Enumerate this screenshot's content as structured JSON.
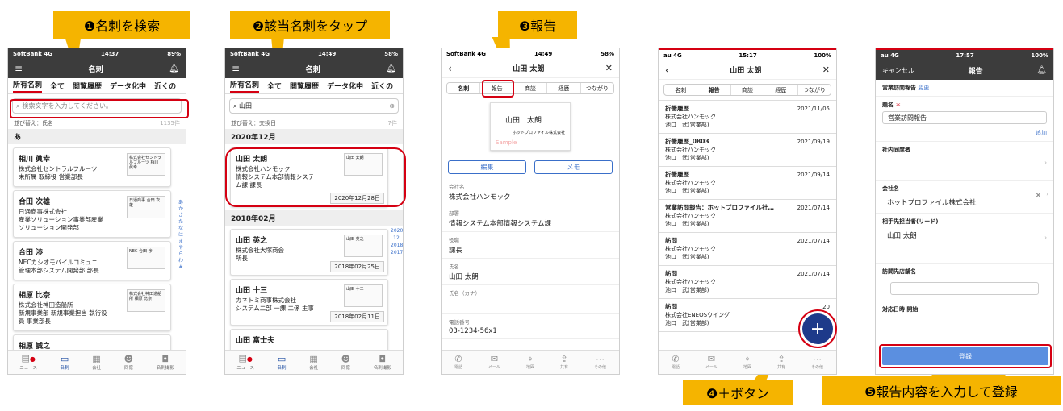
{
  "callouts": {
    "c1": "❶名刺を検索",
    "c2": "❷該当名刺をタップ",
    "c3": "❸報告",
    "c4": "❹＋ボタン",
    "c5": "❺報告内容を入力して登録"
  },
  "p1": {
    "carrier": "SoftBank 4G",
    "time": "14:37",
    "battery": "89%",
    "title": "名刺",
    "tabs": [
      "所有名刺",
      "全て",
      "閲覧履歴",
      "データ化中",
      "近くの"
    ],
    "search_placeholder": "検索文字を入力してください。",
    "sort": "並び替え：氏名",
    "count": "1135件",
    "section": "あ",
    "cards": [
      {
        "name": "相川 眞幸",
        "l1": "株式会社セントラルフルーツ",
        "l2": "未所属 取締役 営業部長",
        "thumb": "株式会社セントラルフルーツ 相川 眞幸"
      },
      {
        "name": "合田 次雄",
        "l1": "日通商事株式会社",
        "l2": "産業ソリューション事業部産業",
        "l3": "ソリューション開発部",
        "thumb": "日通商事 合田 次雄"
      },
      {
        "name": "合田 渉",
        "l1": "NECカシオモバイルコミュニ…",
        "l2": "管理本部システム開発部 部長",
        "thumb": "NEC 合田 渉"
      },
      {
        "name": "相原 比奈",
        "l1": "株式会社神田造船所",
        "l2": "新規事業部 新規事業担当 執行役",
        "l3": "員 事業部長",
        "thumb": "株式会社神田造船所 相原 比奈"
      },
      {
        "name": "相原 誠之"
      }
    ],
    "index": [
      "あ",
      "か",
      "さ",
      "た",
      "な",
      "は",
      "ま",
      "や",
      "ら",
      "わ",
      "#"
    ],
    "nav": [
      "ニュース",
      "名刺",
      "会社",
      "同僚",
      "名刺撮影"
    ]
  },
  "p2": {
    "carrier": "SoftBank 4G",
    "time": "14:49",
    "battery": "58%",
    "title": "名刺",
    "tabs": [
      "所有名刺",
      "全て",
      "閲覧履歴",
      "データ化中",
      "近くの"
    ],
    "search_value": "山田",
    "sort": "並び替え：交換日",
    "count": "7件",
    "sections": [
      "2020年12月",
      "2018年02月"
    ],
    "cards": [
      {
        "name": "山田 太朗",
        "l1": "株式会社ハンモック",
        "l2": "情報システム本部情報システ",
        "l3": "ム課 課長",
        "date": "2020年12月28日",
        "thumb": "山田 太朗"
      },
      {
        "name": "山田 英之",
        "l1": "株式会社大塚商会",
        "l2": "所長",
        "date": "2018年02月25日",
        "thumb": "山田 英之"
      },
      {
        "name": "山田 十三",
        "l1": "カネトミ商事株式会社",
        "l2": "システム二部 一課 二係 主事",
        "date": "2018年02月11日",
        "thumb": "山田 十三"
      },
      {
        "name": "山田 富士夫"
      }
    ],
    "years": [
      "2020",
      "12",
      "2018",
      "2017"
    ],
    "nav": [
      "ニュース",
      "名刺",
      "会社",
      "同僚",
      "名刺撮影"
    ]
  },
  "p3": {
    "carrier": "SoftBank 4G",
    "time": "14:49",
    "battery": "58%",
    "title": "山田 太朗",
    "seg": [
      "名刺",
      "報告",
      "商談",
      "経歴",
      "つながり"
    ],
    "card_name": "山田　太朗",
    "card_company": "ホットプロファイル株式会社",
    "sample": "Sample",
    "btn_edit": "編集",
    "btn_memo": "メモ",
    "fields": [
      {
        "label": "会社名",
        "value": "株式会社ハンモック"
      },
      {
        "label": "部署",
        "value": "情報システム本部情報システム課"
      },
      {
        "label": "役職",
        "value": "課長"
      },
      {
        "label": "氏名",
        "value": "山田 太朗"
      },
      {
        "label": "氏名（カナ）",
        "value": ""
      },
      {
        "label": "電話番号",
        "value": "03-1234-56x1"
      }
    ],
    "actions": [
      "電話",
      "メール",
      "地図",
      "共有",
      "その他"
    ]
  },
  "p4": {
    "carrier": "au 4G",
    "time": "15:17",
    "battery": "100%",
    "title": "山田 太朗",
    "seg": [
      "名刺",
      "報告",
      "商談",
      "経歴",
      "つながり"
    ],
    "items": [
      {
        "t": "折衝履歴",
        "d": "2021/11/05",
        "c": "株式会社ハンモック",
        "p": "池口　武(営業部)"
      },
      {
        "t": "折衝履歴_0803",
        "d": "2021/09/19",
        "c": "株式会社ハンモック",
        "p": "池口　武(営業部)"
      },
      {
        "t": "折衝履歴",
        "d": "2021/09/14",
        "c": "株式会社ハンモック",
        "p": "池口　武(営業部)"
      },
      {
        "t": "営業訪問報告：ホットプロファイル社…",
        "d": "2021/07/14",
        "c": "株式会社ハンモック",
        "p": "池口　武(営業部)"
      },
      {
        "t": "訪問",
        "d": "2021/07/14",
        "c": "株式会社ハンモック",
        "p": "池口　武(営業部)"
      },
      {
        "t": "訪問",
        "d": "2021/07/14",
        "c": "株式会社ハンモック",
        "p": "池口　武(営業部)"
      },
      {
        "t": "訪問",
        "d": "20",
        "c": "株式会社ENEOSウイング",
        "p": "池口　武(営業部)"
      }
    ],
    "actions": [
      "電話",
      "メール",
      "地図",
      "共有",
      "その他"
    ]
  },
  "p5": {
    "carrier": "au 4G",
    "time": "17:57",
    "battery": "100%",
    "cancel": "キャンセル",
    "title": "報告",
    "report_type": "営業訪問報告",
    "change": "変更",
    "subject_label": "題名",
    "subject_value": "営業訪問報告",
    "add": "追加",
    "internal_label": "社内同席者",
    "company_label": "会社名",
    "company_value": "ホットプロファイル株式会社",
    "contact_label": "相手先担当者(リード)",
    "contact_value": "山田 太朗",
    "store_label": "訪問先店舗名",
    "datetime_label": "対応日時 開始",
    "register": "登録"
  }
}
